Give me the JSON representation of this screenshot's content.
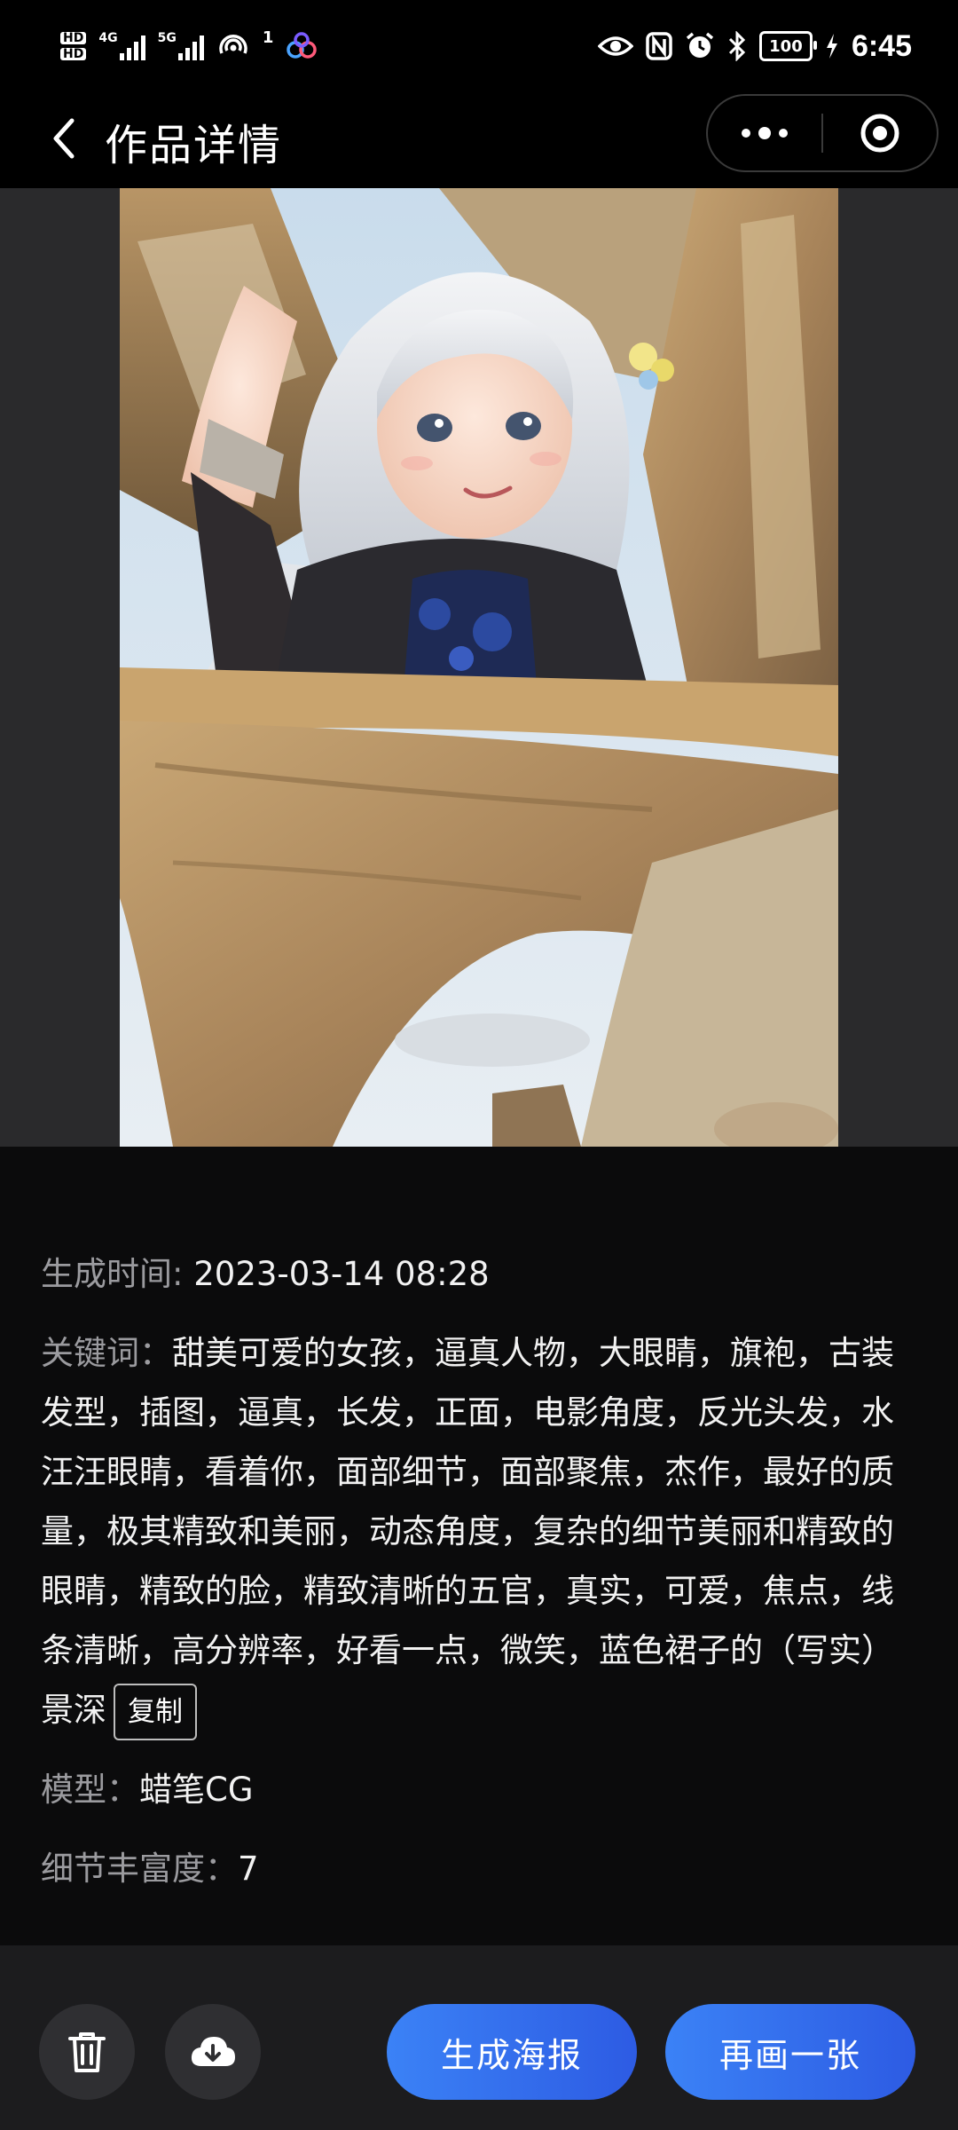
{
  "status_bar": {
    "time": "6:45",
    "battery": "100",
    "network_1": "4G",
    "network_2": "5G",
    "hotspot_count": "1",
    "hd_label": "HD"
  },
  "header": {
    "title": "作品详情"
  },
  "details": {
    "time_label": "生成时间: ",
    "time_value": "2023-03-14 08:28",
    "keywords_label": "关键词：",
    "keywords_value": "甜美可爱的女孩，逼真人物，大眼睛，旗袍，古装发型，插图，逼真，长发，正面，电影角度，反光头发，水汪汪眼睛，看着你，面部细节，面部聚焦，杰作，最好的质量，极其精致和美丽，动态角度，复杂的细节美丽和精致的眼睛，精致的脸，精致清晰的五官，真实，可爱，焦点，线条清晰，高分辨率，好看一点，微笑，蓝色裙子的（写实）景深",
    "copy_label": "复制",
    "model_label": "模型：",
    "model_value": "蜡笔CG",
    "detail_label": "细节丰富度：",
    "detail_value": "7"
  },
  "actions": {
    "poster_label": "生成海报",
    "redraw_label": "再画一张"
  },
  "colors": {
    "accent": "#3b82f6",
    "background": "#0b0b0c",
    "bottom_bar": "#1c1c1e"
  }
}
